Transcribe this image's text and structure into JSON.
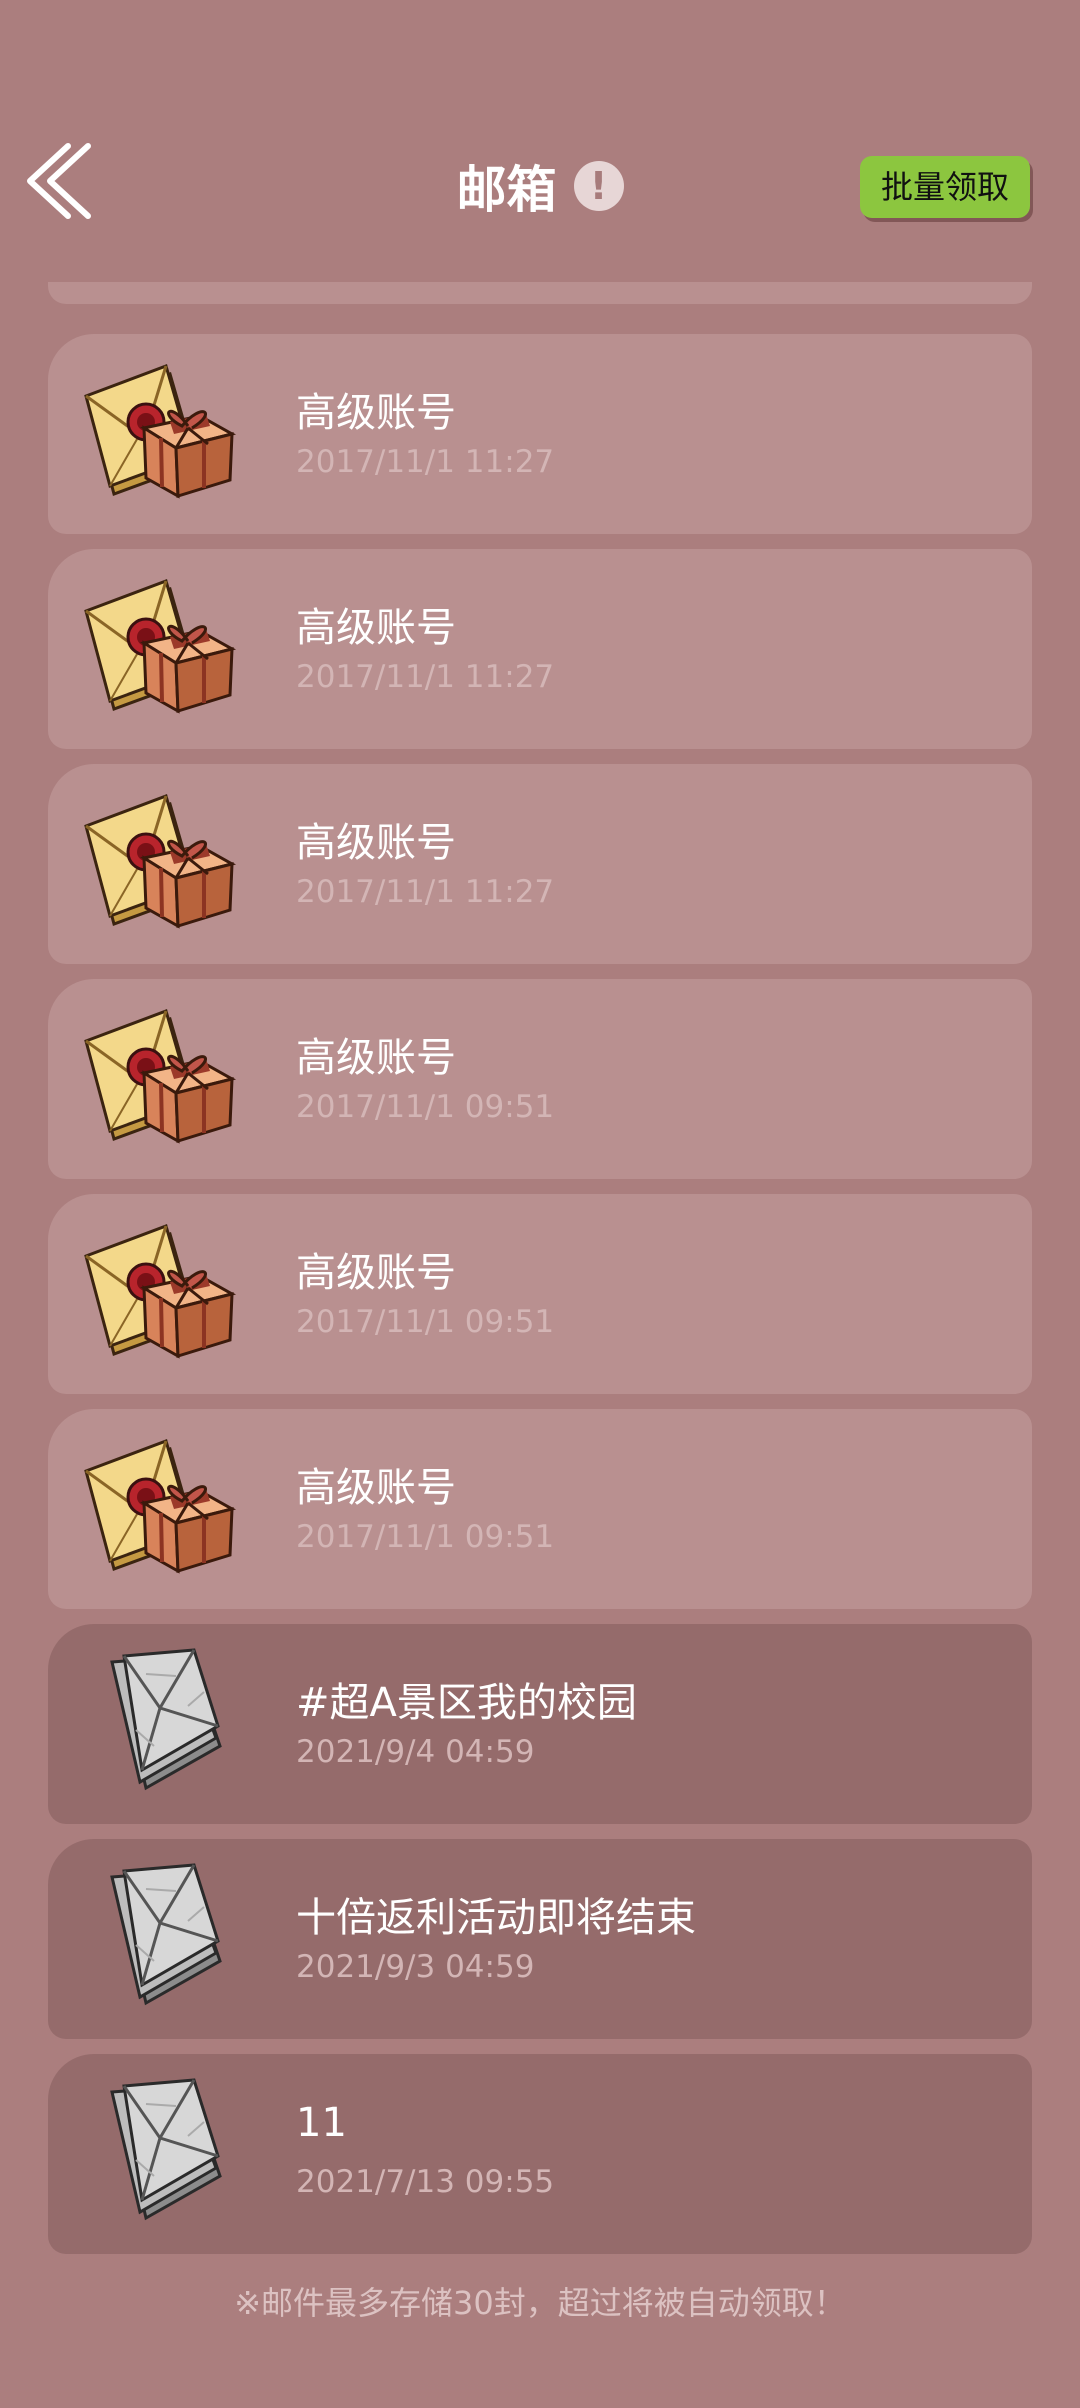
{
  "header": {
    "title": "邮箱",
    "info_glyph": "!",
    "batch_button": "批量领取",
    "icons": {
      "back": "double-chevron-left-icon",
      "info": "info-icon"
    }
  },
  "mails": [
    {
      "kind": "gift",
      "title": "高级账号",
      "time": "2017/11/1  11:27"
    },
    {
      "kind": "gift",
      "title": "高级账号",
      "time": "2017/11/1  11:27"
    },
    {
      "kind": "gift",
      "title": "高级账号",
      "time": "2017/11/1  11:27"
    },
    {
      "kind": "gift",
      "title": "高级账号",
      "time": "2017/11/1  09:51"
    },
    {
      "kind": "gift",
      "title": "高级账号",
      "time": "2017/11/1  09:51"
    },
    {
      "kind": "gift",
      "title": "高级账号",
      "time": "2017/11/1  09:51"
    },
    {
      "kind": "plain",
      "title": "#超A景区我的校园",
      "time": "2021/9/4  04:59"
    },
    {
      "kind": "plain",
      "title": "十倍返利活动即将结束",
      "time": "2021/9/3  04:59"
    },
    {
      "kind": "plain",
      "title": "11",
      "time": "2021/7/13  09:55"
    }
  ],
  "footer": {
    "note": "※邮件最多存储30封，超过将被自动领取！"
  },
  "colors": {
    "background": "#ab7e7e",
    "gift_card": "#b99090",
    "plain_card": "#956b6b",
    "batch_button": "#8cc63f"
  }
}
